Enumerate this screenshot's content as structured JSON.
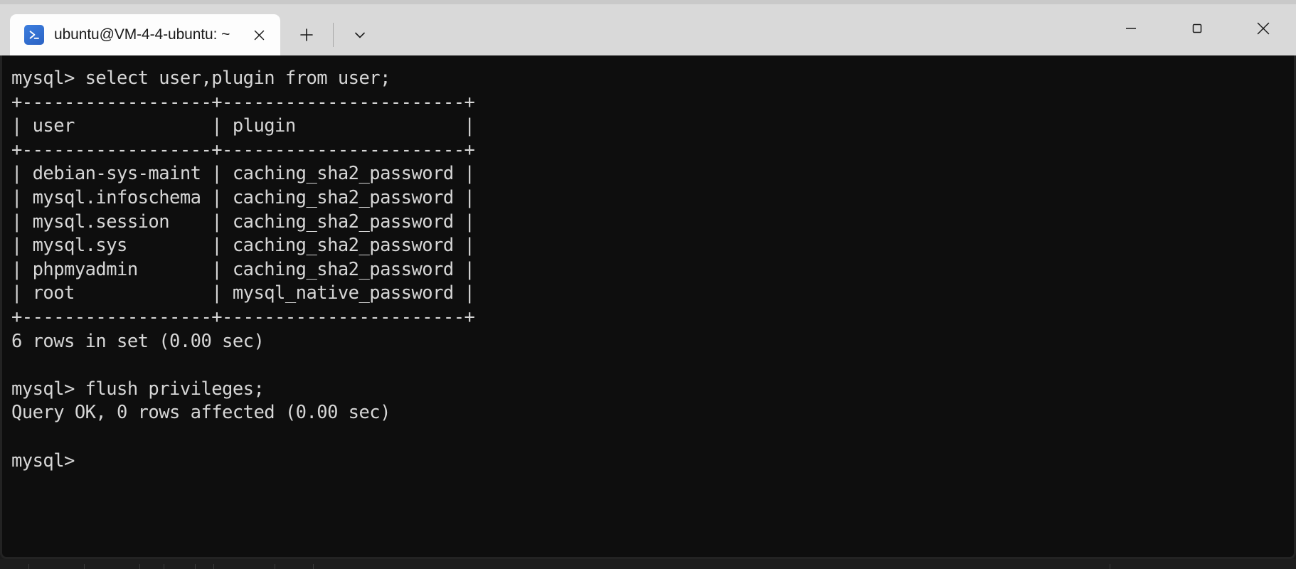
{
  "window": {
    "tab": {
      "title": "ubuntu@VM-4-4-ubuntu: ~",
      "icon": "terminal-prompt-icon",
      "close_label": "✕"
    },
    "new_tab_label": "+",
    "dropdown_label": "⌄",
    "controls": {
      "minimize_label": "─",
      "maximize_label": "□",
      "close_label": "✕"
    },
    "colors": {
      "titlebar_bg": "#d9d9d9",
      "active_tab_bg": "#fdfdfd",
      "terminal_bg": "#0e0e0e",
      "terminal_fg": "#d6d6d6",
      "icon_blue": "#2f6fd0"
    }
  },
  "terminal": {
    "prompt": "mysql>",
    "lines": [
      "mysql> select user,plugin from user;",
      "+------------------+-----------------------+",
      "| user             | plugin                |",
      "+------------------+-----------------------+",
      "| debian-sys-maint | caching_sha2_password |",
      "| mysql.infoschema | caching_sha2_password |",
      "| mysql.session    | caching_sha2_password |",
      "| mysql.sys        | caching_sha2_password |",
      "| phpmyadmin       | caching_sha2_password |",
      "| root             | mysql_native_password |",
      "+------------------+-----------------------+",
      "6 rows in set (0.00 sec)",
      "",
      "mysql> flush privileges;",
      "Query OK, 0 rows affected (0.00 sec)",
      "",
      "mysql> "
    ],
    "commands": [
      {
        "prompt": "mysql>",
        "text": "select user,plugin from user;"
      },
      {
        "prompt": "mysql>",
        "text": "flush privileges;"
      },
      {
        "prompt": "mysql>",
        "text": ""
      }
    ],
    "result_table": {
      "columns": [
        "user",
        "plugin"
      ],
      "rows": [
        [
          "debian-sys-maint",
          "caching_sha2_password"
        ],
        [
          "mysql.infoschema",
          "caching_sha2_password"
        ],
        [
          "mysql.session",
          "caching_sha2_password"
        ],
        [
          "mysql.sys",
          "caching_sha2_password"
        ],
        [
          "phpmyadmin",
          "caching_sha2_password"
        ],
        [
          "root",
          "mysql_native_password"
        ]
      ],
      "row_count_message": "6 rows in set (0.00 sec)"
    },
    "flush_result_message": "Query OK, 0 rows affected (0.00 sec)"
  }
}
